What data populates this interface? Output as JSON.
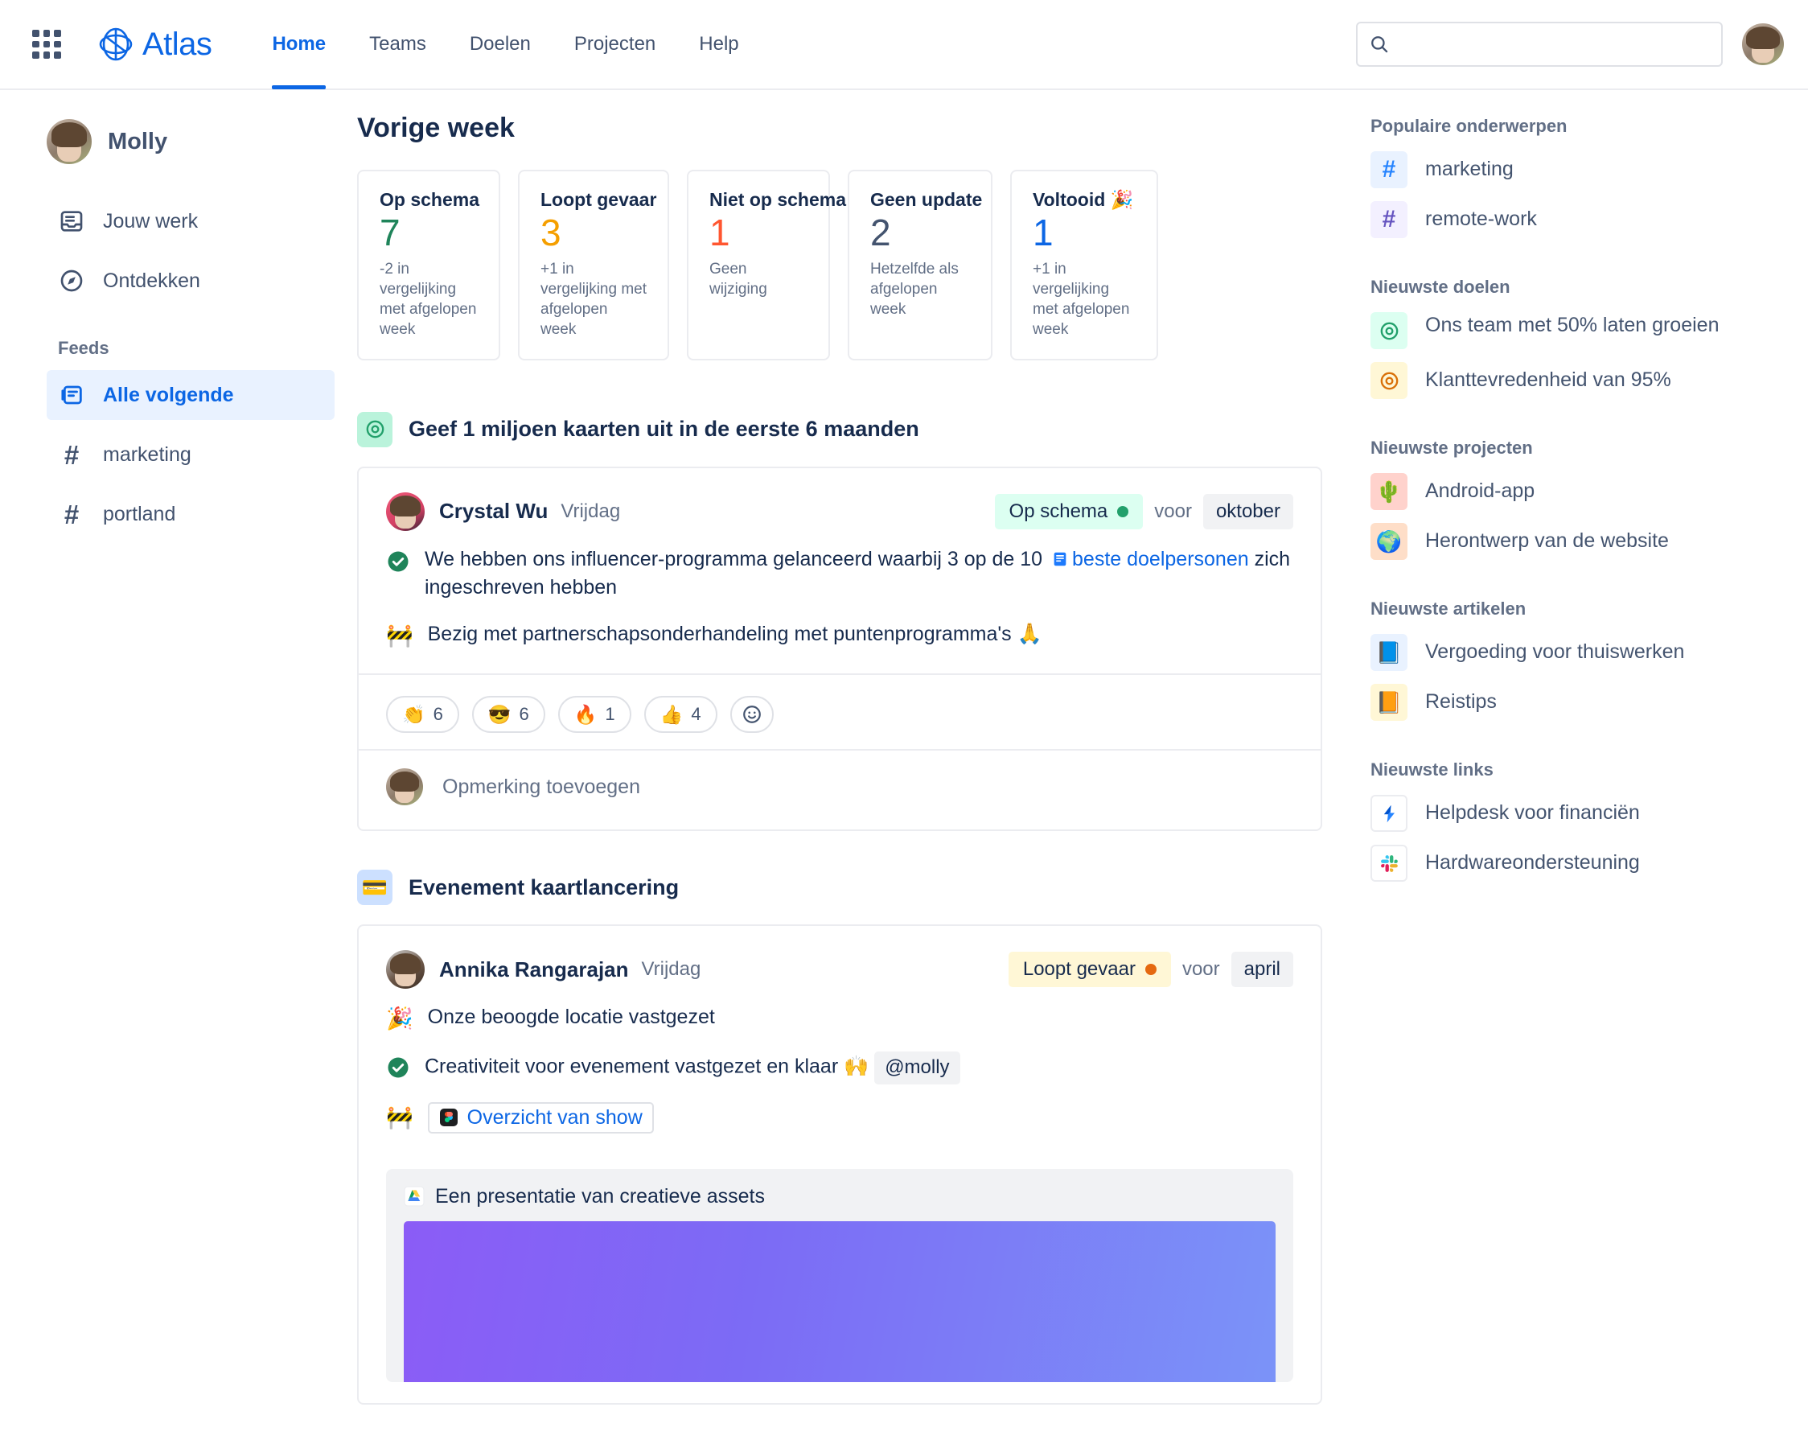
{
  "topnav": {
    "app_switcher_icon": "grid-apps-icon",
    "brand": "Atlas",
    "links": [
      {
        "label": "Home",
        "active": true
      },
      {
        "label": "Teams",
        "active": false
      },
      {
        "label": "Doelen",
        "active": false
      },
      {
        "label": "Projecten",
        "active": false
      },
      {
        "label": "Help",
        "active": false
      }
    ],
    "search": {
      "value": "",
      "placeholder": "",
      "icon": "search-icon"
    },
    "profile_avatar": "molly-avatar"
  },
  "sidebar": {
    "user": "Molly",
    "items": [
      {
        "label": "Jouw werk",
        "icon": "your-work-icon"
      },
      {
        "label": "Ontdekken",
        "icon": "compass-icon"
      }
    ],
    "feeds_title": "Feeds",
    "feeds": [
      {
        "label": "Alle volgende",
        "icon": "feed-icon",
        "active": true
      },
      {
        "label": "marketing",
        "icon": "hash-icon",
        "active": false
      },
      {
        "label": "portland",
        "icon": "hash-icon",
        "active": false
      }
    ]
  },
  "main": {
    "title": "Vorige week",
    "stats": [
      {
        "label": "Op schema",
        "value": "7",
        "color": "#1F845A",
        "sub": "-2 in vergelijking met afgelopen week"
      },
      {
        "label": "Loopt gevaar",
        "value": "3",
        "color": "#F59F00",
        "sub": "+1 in vergelijking met afgelopen week"
      },
      {
        "label": "Niet op schema",
        "value": "1",
        "color": "#FF5630",
        "sub": "Geen wijziging"
      },
      {
        "label": "Geen update",
        "value": "2",
        "color": "#44546F",
        "sub": "Hetzelfde als afgelopen week"
      },
      {
        "label": "Voltooid 🎉",
        "value": "1",
        "color": "#0C66E4",
        "sub": "+1 in vergelijking met afgelopen week"
      }
    ],
    "posts": [
      {
        "badge_emoji": "◎",
        "badge_kind": "goal",
        "title": "Geef 1 miljoen kaarten uit in de eerste 6 maanden",
        "author": "Crystal Wu",
        "date": "Vrijdag",
        "status_label": "Op schema",
        "status_kind": "ontrack",
        "voor": "voor",
        "month": "oktober",
        "lines": [
          {
            "emoji": "check",
            "text_before": "We hebben ons influencer-programma gelanceerd waarbij 3 op de 10 ",
            "link_text": "beste doelpersonen",
            "text_after": " zich ingeschreven hebben",
            "link_icon": "page-icon"
          },
          {
            "emoji": "🚧",
            "text_before": "Bezig met partnerschapsonderhandeling met puntenprogramma's 🙏",
            "link_text": "",
            "text_after": ""
          }
        ],
        "reactions": [
          {
            "emoji": "👏",
            "count": "6"
          },
          {
            "emoji": "😎",
            "count": "6"
          },
          {
            "emoji": "🔥",
            "count": "1"
          },
          {
            "emoji": "👍",
            "count": "4"
          }
        ],
        "add_reaction_icon": "add-reaction-icon",
        "comment_placeholder": "Opmerking toevoegen"
      },
      {
        "badge_emoji": "💳",
        "badge_kind": "project",
        "title": "Evenement kaartlancering",
        "author": "Annika Rangarajan",
        "date": "Vrijdag",
        "status_label": "Loopt gevaar",
        "status_kind": "atrisk",
        "voor": "voor",
        "month": "april",
        "lines": [
          {
            "emoji": "🎉",
            "text_before": "Onze beoogde locatie vastgezet"
          },
          {
            "emoji": "check",
            "text_before": "Creativiteit voor evenement vastgezet en klaar 🙌",
            "mention": "@molly"
          },
          {
            "emoji": "🚧",
            "link_chip": "Overzicht van show",
            "link_chip_icon": "figma-icon"
          }
        ],
        "attachment": {
          "title": "Een presentatie van creatieve assets",
          "icon": "google-drive-icon"
        }
      }
    ]
  },
  "rail": {
    "sections": [
      {
        "title": "Populaire onderwerpen",
        "items": [
          {
            "label": "marketing",
            "icon": "hash-icon",
            "style": "hash-blue"
          },
          {
            "label": "remote-work",
            "icon": "hash-icon",
            "style": "hash-purple"
          }
        ]
      },
      {
        "title": "Nieuwste doelen",
        "items": [
          {
            "label": "Ons team met 50% laten groeien",
            "icon": "goal-icon",
            "style": "goal-green"
          },
          {
            "label": "Klanttevredenheid van 95%",
            "icon": "goal-icon",
            "style": "goal-orange"
          }
        ]
      },
      {
        "title": "Nieuwste projecten",
        "items": [
          {
            "label": "Android-app",
            "icon": "cactus-icon",
            "style": "pink",
            "emoji": "🌵"
          },
          {
            "label": "Herontwerp van de website",
            "icon": "globe-icon",
            "style": "peach",
            "emoji": "🌍"
          }
        ]
      },
      {
        "title": "Nieuwste artikelen",
        "items": [
          {
            "label": "Vergoeding voor thuiswerken",
            "icon": "book-icon",
            "style": "lightblue",
            "emoji": "📘"
          },
          {
            "label": "Reistips",
            "icon": "book-icon",
            "style": "cream",
            "emoji": "📙"
          }
        ]
      },
      {
        "title": "Nieuwste links",
        "items": [
          {
            "label": "Helpdesk voor financiën",
            "icon": "jira-service-management-icon",
            "style": "plain"
          },
          {
            "label": "Hardwareondersteuning",
            "icon": "slack-icon",
            "style": "plain"
          }
        ]
      }
    ]
  }
}
